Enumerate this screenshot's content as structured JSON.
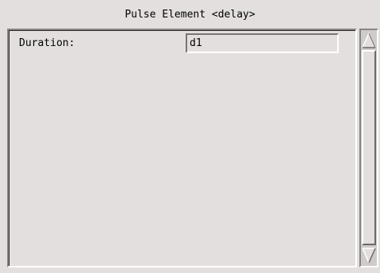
{
  "window": {
    "title": "Pulse Element <delay>"
  },
  "form": {
    "duration_label": "Duration:",
    "duration_value": "d1"
  },
  "scrollbar": {
    "up_icon": "triangle-up-icon",
    "down_icon": "triangle-down-icon"
  }
}
